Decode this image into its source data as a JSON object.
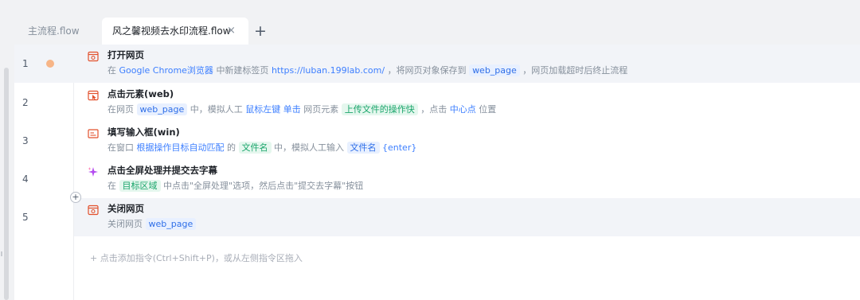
{
  "tabs": {
    "main": "主流程.flow",
    "active": "风之馨视频去水印流程.flow",
    "close_glyph": "×",
    "add_glyph": "+"
  },
  "rows": [
    {
      "line": "1",
      "icon": "browser-icon",
      "title": "打开网页",
      "desc": {
        "p1": "在",
        "k1": "Google Chrome浏览器",
        "p2": "中新建标签页",
        "k2": "https://luban.199lab.com/",
        "p3": "，将网页对象保存到",
        "c1": "web_page",
        "p4": "，网页加载超时后终止流程"
      }
    },
    {
      "line": "2",
      "icon": "click-element-icon",
      "title": "点击元素(web)",
      "desc": {
        "p1": "在网页",
        "c1": "web_page",
        "p2": "中，模拟人工",
        "k1": "鼠标左键",
        "k2": "单击",
        "p3": "网页元素",
        "c2": "上传文件的操作快",
        "p4": "，点击",
        "k3": "中心点",
        "p5": "位置"
      }
    },
    {
      "line": "3",
      "icon": "input-box-icon",
      "title": "填写输入框(win)",
      "desc": {
        "p1": "在窗口",
        "k1": "根据操作目标自动匹配",
        "p2": "的",
        "c1": "文件名",
        "p3": "中，模拟人工输入",
        "c2": "文件名",
        "k2": "{enter}"
      }
    },
    {
      "line": "4",
      "icon": "ai-sparkle-icon",
      "title": "点击全屏处理并提交去字幕",
      "desc": {
        "p1": "在",
        "c1": "目标区域",
        "p2": "中点击\"全屏处理\"选项，然后点击\"提交去字幕\"按钮"
      }
    },
    {
      "line": "5",
      "icon": "browser-close-icon",
      "title": "关闭网页",
      "desc": {
        "p1": "关闭网页",
        "c1": "web_page"
      }
    }
  ],
  "add_node_glyph": "+",
  "hint": "+ 点击添加指令(Ctrl+Shift+P)，或从左侧指令区拖入",
  "colors": {
    "keyword": "#3d7fff",
    "var_chip": "#2f6fe8",
    "element_chip": "#1aa56b",
    "breakpoint": "#f7b587",
    "highlight_row": "#f2f4f8"
  }
}
